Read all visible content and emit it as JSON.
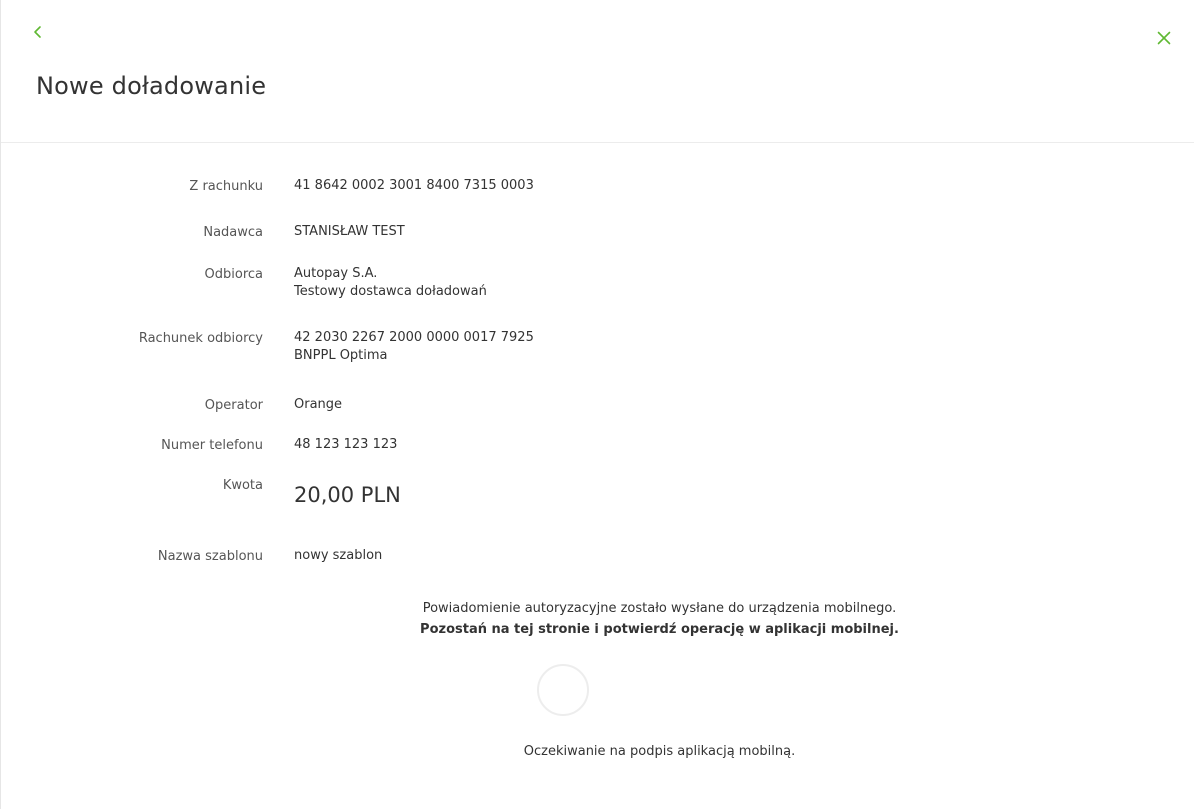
{
  "title": "Nowe doładowanie",
  "nav": {
    "back_icon": "chevron-left-icon",
    "close_icon": "close-icon",
    "accent_color": "#5fb832"
  },
  "details": {
    "from_account": {
      "label": "Z rachunku",
      "value": "41 8642 0002 3001 8400 7315 0003"
    },
    "sender": {
      "label": "Nadawca",
      "value": "STANISŁAW TEST"
    },
    "recipient": {
      "label": "Odbiorca",
      "line1": "Autopay S.A.",
      "line2": "Testowy dostawca doładowań"
    },
    "recipient_account": {
      "label": "Rachunek odbiorcy",
      "line1": "42 2030 2267 2000 0000 0017 7925",
      "line2": "BNPPL Optima"
    },
    "operator": {
      "label": "Operator",
      "value": "Orange"
    },
    "phone": {
      "label": "Numer telefonu",
      "value": "48 123 123 123"
    },
    "amount": {
      "label": "Kwota",
      "value": "20,00 PLN"
    },
    "template_name": {
      "label": "Nazwa szablonu",
      "value": "nowy szablon"
    }
  },
  "notice": {
    "line1": "Powiadomienie autoryzacyjne zostało wysłane do urządzenia mobilnego.",
    "line2": "Pozostań na tej stronie i potwierdź operację w aplikacji mobilnej."
  },
  "waiting_text": "Oczekiwanie na podpis aplikacją mobilną."
}
